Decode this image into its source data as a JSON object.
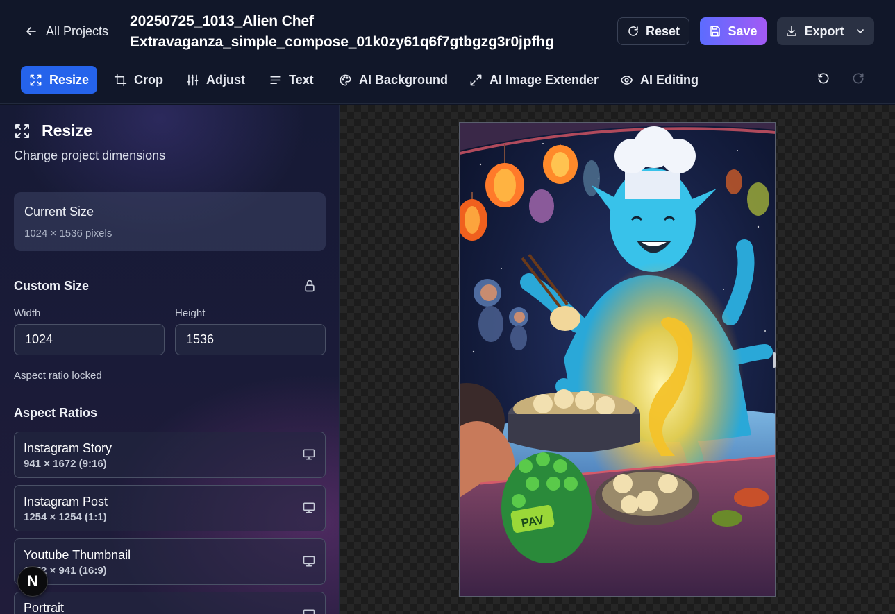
{
  "header": {
    "back_label": "All Projects",
    "project_title_line1": "20250725_1013_Alien Chef",
    "project_title_line2": "Extravaganza_simple_compose_01k0zy61q6f7gtbgzg3r0jpfhg",
    "reset_label": "Reset",
    "save_label": "Save",
    "export_label": "Export"
  },
  "toolbar": {
    "tools": [
      {
        "label": "Resize",
        "icon": "expand-icon",
        "active": true
      },
      {
        "label": "Crop",
        "icon": "crop-icon"
      },
      {
        "label": "Adjust",
        "icon": "sliders-icon"
      },
      {
        "label": "Text",
        "icon": "text-lines-icon"
      },
      {
        "label": "AI Background",
        "icon": "palette-icon"
      },
      {
        "label": "AI Image Extender",
        "icon": "diagonal-arrows-icon"
      },
      {
        "label": "AI Editing",
        "icon": "eye-icon"
      }
    ]
  },
  "panel": {
    "title": "Resize",
    "subtitle": "Change project dimensions",
    "current_size": {
      "label": "Current Size",
      "value": "1024 × 1536 pixels"
    },
    "custom_size": {
      "title": "Custom Size",
      "width_label": "Width",
      "width_value": "1024",
      "height_label": "Height",
      "height_value": "1536",
      "note": "Aspect ratio locked"
    },
    "aspect_ratios": {
      "title": "Aspect Ratios",
      "items": [
        {
          "name": "Instagram Story",
          "dims": "941 × 1672 (9:16)"
        },
        {
          "name": "Instagram Post",
          "dims": "1254 × 1254 (1:1)"
        },
        {
          "name": "Youtube Thumbnail",
          "dims": "1672 × 941 (16:9)"
        },
        {
          "name": "Portrait",
          "dims": ""
        }
      ]
    }
  },
  "badge": {
    "letter": "N"
  },
  "artwork": {
    "sign_text": "PAV"
  },
  "colors": {
    "accent": "#2563eb",
    "save_gradient_start": "#5c6cff",
    "save_gradient_end": "#a35af5",
    "header_bg": "#111729"
  }
}
